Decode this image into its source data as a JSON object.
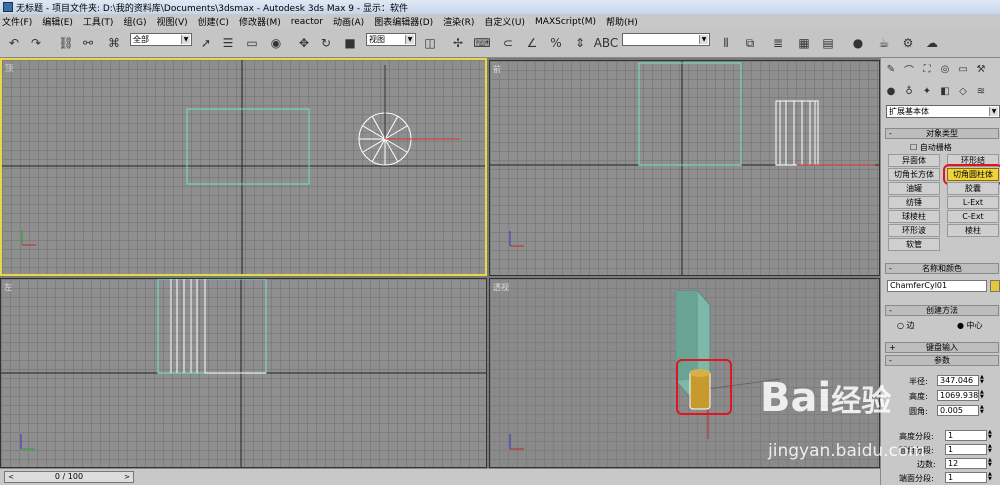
{
  "title": {
    "app_icon": "3dsmax-icon",
    "text": "无标题  - 项目文件夹: D:\\我的资料库\\Documents\\3dsmax    - Autodesk 3ds Max 9    - 显示：软件"
  },
  "menu": [
    "文件(F)",
    "编辑(E)",
    "工具(T)",
    "组(G)",
    "视图(V)",
    "创建(C)",
    "修改器(M)",
    "reactor",
    "动画(A)",
    "图表编辑器(D)",
    "渲染(R)",
    "自定义(U)",
    "MAXScript(M)",
    "帮助(H)"
  ],
  "toolbar": {
    "selection_filter": "全部",
    "ref_coord": "视图",
    "named_sel": ""
  },
  "viewports": {
    "top": "顶",
    "front": "前",
    "left": "左",
    "persp": "透视"
  },
  "status": {
    "time": "0 / 100",
    "prev": "<",
    "next": ">"
  },
  "panel": {
    "category": "扩展基本体",
    "object_type_header": "对象类型",
    "autogrid": "自动栅格",
    "buttons": [
      [
        "异面体",
        "环形结"
      ],
      [
        "切角长方体",
        "切角圆柱体"
      ],
      [
        "油罐",
        "胶囊"
      ],
      [
        "纺锤",
        "L-Ext"
      ],
      [
        "球棱柱",
        "C-Ext"
      ],
      [
        "环形波",
        "棱柱"
      ],
      [
        "软管",
        ""
      ]
    ],
    "name_color_header": "名称和颜色",
    "object_name": "ChamferCyl01",
    "object_color": "#e8c43a",
    "creation_header": "创建方法",
    "edge_label": "边",
    "center_label": "中心",
    "keyboard_header": "键盘输入",
    "params_header": "参数",
    "radius_label": "半径:",
    "radius_value": "347.046",
    "height_label": "高度:",
    "height_value": "1069.938",
    "fillet_label": "圆角:",
    "fillet_value": "0.005",
    "hseg_label": "高度分段:",
    "hseg_value": "1",
    "fseg_label": "圆角分段:",
    "fseg_value": "1",
    "sides_label": "边数:",
    "sides_value": "12",
    "cseg_label": "端面分段:",
    "cseg_value": "1"
  },
  "watermark": {
    "brand": "Bai",
    "brand2": "经验",
    "url": "jingyan.baidu.com"
  }
}
